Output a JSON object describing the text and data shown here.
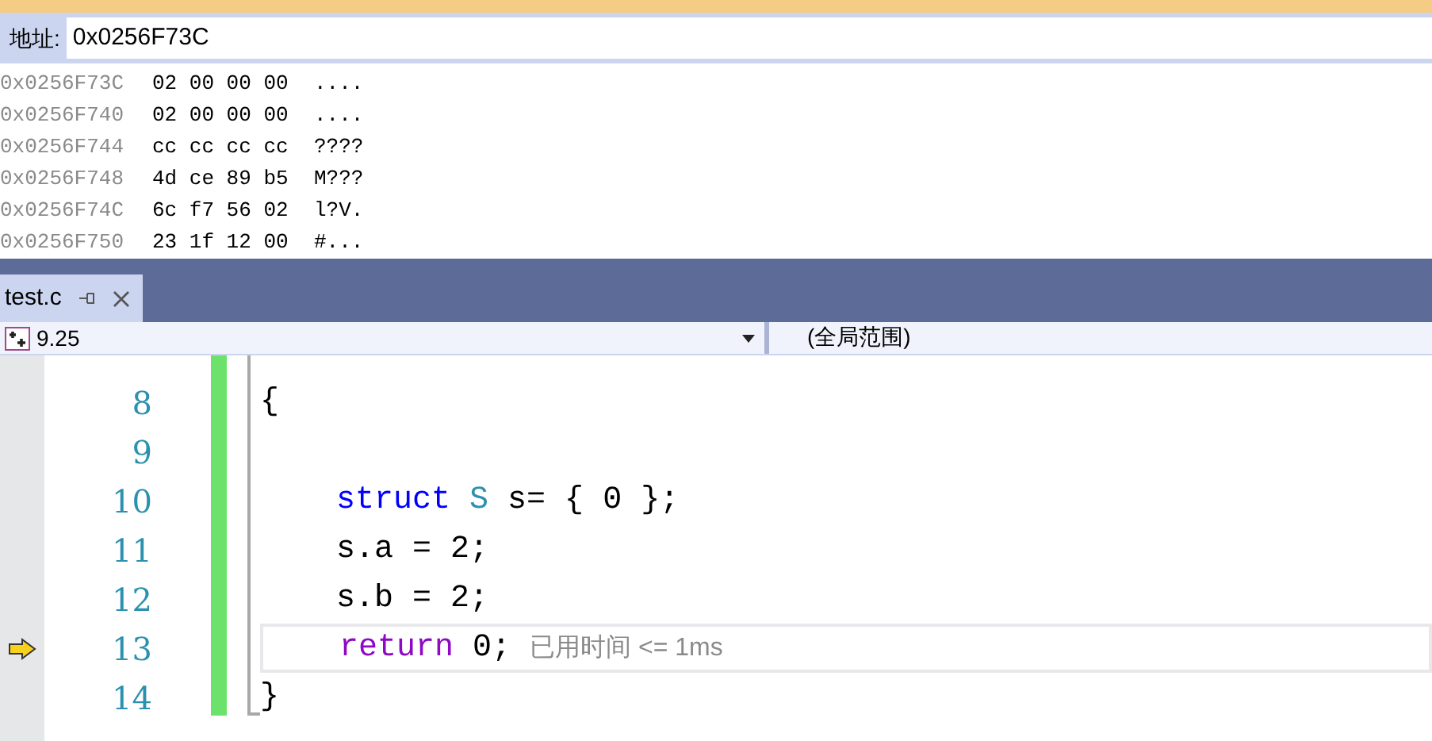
{
  "memory": {
    "address_label": "地址:",
    "address": "0x0256F73C",
    "rows": [
      {
        "address": "0x0256F73C",
        "bytes": "02 00 00 00",
        "chars": "...."
      },
      {
        "address": "0x0256F740",
        "bytes": "02 00 00 00",
        "chars": "...."
      },
      {
        "address": "0x0256F744",
        "bytes": "cc cc cc cc",
        "chars": "????"
      },
      {
        "address": "0x0256F748",
        "bytes": "4d ce 89 b5",
        "chars": "M???"
      },
      {
        "address": "0x0256F74C",
        "bytes": "6c f7 56 02",
        "chars": "l?V."
      },
      {
        "address": "0x0256F750",
        "bytes": "23 1f 12 00",
        "chars": "#..."
      }
    ]
  },
  "tabs": [
    {
      "label": "test.c",
      "selected": true
    }
  ],
  "nav": {
    "scope": "9.25",
    "context": "(全局范围)"
  },
  "code": {
    "lines": [
      {
        "number": "8",
        "current": false,
        "tokens": [
          {
            "kind": "plain",
            "text": "{"
          }
        ]
      },
      {
        "number": "9",
        "current": false
      },
      {
        "number": "10",
        "current": false,
        "tokens": [
          {
            "kind": "keyword",
            "text": "struct"
          },
          {
            "kind": "type",
            "text": "S"
          },
          {
            "kind": "plain",
            "text": "s="
          },
          {
            "kind": "plain",
            "text": "{"
          },
          {
            "kind": "plain",
            "text": "0"
          },
          {
            "kind": "plain",
            "text": "};"
          }
        ]
      },
      {
        "number": "11",
        "current": false,
        "tokens": [
          {
            "kind": "plain",
            "text": "s.a = 2;"
          }
        ]
      },
      {
        "number": "12",
        "current": false,
        "tokens": [
          {
            "kind": "plain",
            "text": "s.b = 2;"
          }
        ]
      },
      {
        "number": "13",
        "current": true,
        "tokens": [
          {
            "kind": "control",
            "text": "return"
          },
          {
            "kind": "plain",
            "text": "0;"
          }
        ],
        "hint": "已用时间 <= 1ms"
      },
      {
        "number": "14",
        "current": false,
        "tokens": [
          {
            "kind": "plain",
            "text": "}"
          }
        ]
      }
    ]
  }
}
